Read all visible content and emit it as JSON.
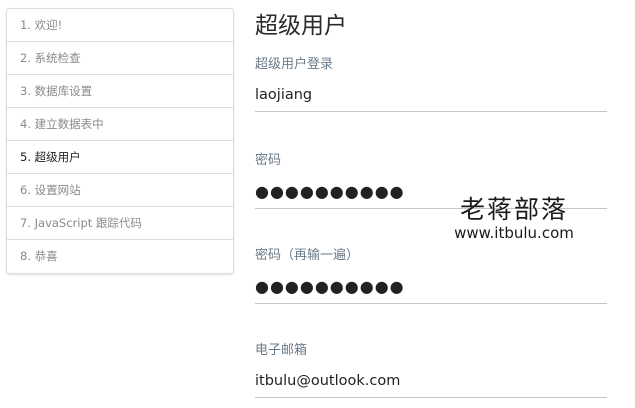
{
  "sidebar": {
    "items": [
      {
        "label": "1. 欢迎!"
      },
      {
        "label": "2. 系统检查"
      },
      {
        "label": "3. 数据库设置"
      },
      {
        "label": "4. 建立数据表中"
      },
      {
        "label": "5. 超级用户"
      },
      {
        "label": "6. 设置网站"
      },
      {
        "label": "7. JavaScript 跟踪代码"
      },
      {
        "label": "8. 恭喜"
      }
    ],
    "active_index": 4
  },
  "main": {
    "title": "超级用户",
    "fields": [
      {
        "label": "超级用户登录",
        "value": "laojiang"
      },
      {
        "label": "密码",
        "value": "●●●●●●●●●●"
      },
      {
        "label": "密码（再输一遍）",
        "value": "●●●●●●●●●●"
      },
      {
        "label": "电子邮箱",
        "value": "itbulu@outlook.com"
      }
    ]
  },
  "watermark": {
    "line1": "老蒋部落",
    "line2": "www.itbulu.com"
  }
}
